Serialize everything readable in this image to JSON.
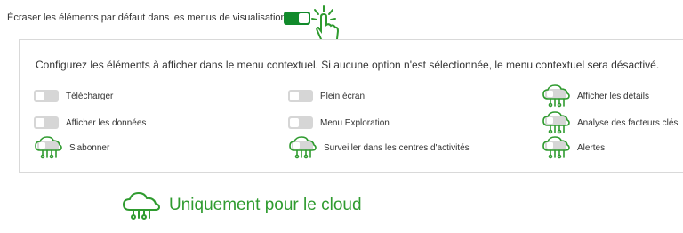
{
  "override": {
    "label": "Écraser les éléments par défaut dans les menus de visualisation",
    "toggle_on": true
  },
  "panel": {
    "description": "Configurez les éléments à afficher dans le menu contextuel. Si aucune option n'est sélectionnée, le menu contextuel sera désactivé.",
    "options": [
      {
        "label": "Télécharger",
        "cloud_only": false,
        "on": false
      },
      {
        "label": "Plein écran",
        "cloud_only": false,
        "on": false
      },
      {
        "label": "Afficher les détails",
        "cloud_only": true,
        "on": false
      },
      {
        "label": "Afficher les données",
        "cloud_only": false,
        "on": false
      },
      {
        "label": "Menu Exploration",
        "cloud_only": false,
        "on": false
      },
      {
        "label": "Analyse des facteurs clés",
        "cloud_only": true,
        "on": false
      },
      {
        "label": "S'abonner",
        "cloud_only": true,
        "on": false
      },
      {
        "label": "Surveiller dans les centres d'activités",
        "cloud_only": true,
        "on": false
      },
      {
        "label": "Alertes",
        "cloud_only": true,
        "on": false
      }
    ]
  },
  "legend": {
    "label": "Uniquement pour le cloud",
    "icon": "cloud-icon"
  },
  "colors": {
    "toggle_on": "#118a2b",
    "toggle_off": "#d6d6d6",
    "cloud_green": "#2f9b2f"
  }
}
